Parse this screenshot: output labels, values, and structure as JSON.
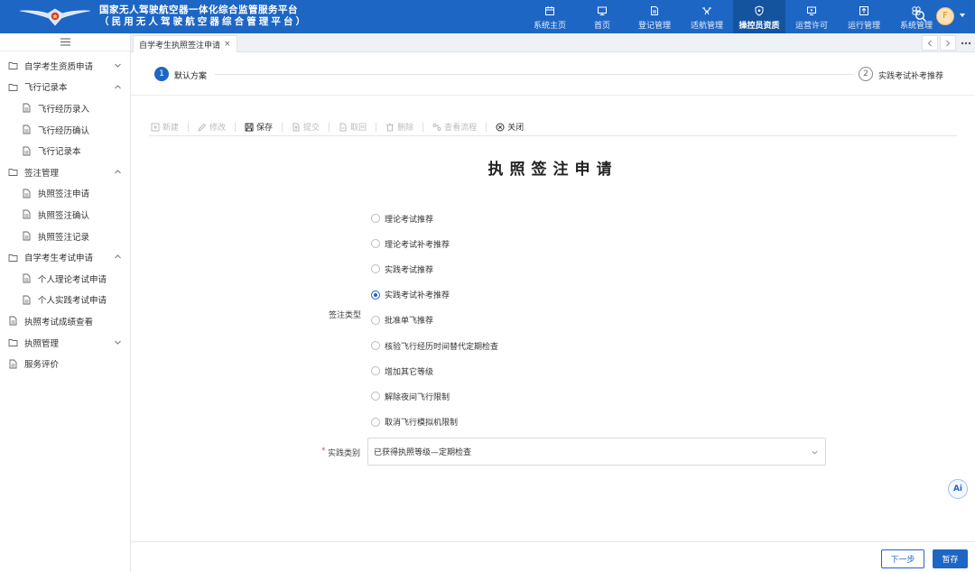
{
  "header": {
    "title": "国家无人驾驶航空器一体化综合监管服务平台",
    "subtitle": "（民用无人驾驶航空器综合管理平台）",
    "avatar_letter": "F",
    "nav": [
      {
        "label": "系统主页",
        "icon": "calendar-icon"
      },
      {
        "label": "首页",
        "icon": "monitor-icon"
      },
      {
        "label": "登记管理",
        "icon": "document-icon"
      },
      {
        "label": "适航管理",
        "icon": "drone-icon"
      },
      {
        "label": "操控员资质",
        "icon": "shield-icon",
        "active": true
      },
      {
        "label": "运营许可",
        "icon": "screen-icon"
      },
      {
        "label": "运行管理",
        "icon": "upload-icon"
      },
      {
        "label": "系统管理",
        "icon": "settings-icon"
      }
    ]
  },
  "sidebar": {
    "items": [
      {
        "label": "自学考生资质申请",
        "level": 0,
        "chev": "down"
      },
      {
        "label": "飞行记录本",
        "level": 0,
        "chev": "up"
      },
      {
        "label": "飞行经历录入",
        "level": 1
      },
      {
        "label": "飞行经历确认",
        "level": 1
      },
      {
        "label": "飞行记录本",
        "level": 1
      },
      {
        "label": "签注管理",
        "level": 0,
        "chev": "up"
      },
      {
        "label": "执照签注申请",
        "level": 1
      },
      {
        "label": "执照签注确认",
        "level": 1
      },
      {
        "label": "执照签注记录",
        "level": 1
      },
      {
        "label": "自学考生考试申请",
        "level": 0,
        "chev": "up"
      },
      {
        "label": "个人理论考试申请",
        "level": 1
      },
      {
        "label": "个人实践考试申请",
        "level": 1
      },
      {
        "label": "执照考试成绩查看",
        "level": 0
      },
      {
        "label": "执照管理",
        "level": 0,
        "chev": "down"
      },
      {
        "label": "服务评价",
        "level": 0
      }
    ]
  },
  "tabs": [
    {
      "label": "自学考生执照签注申请",
      "close": "×"
    }
  ],
  "steps": [
    {
      "num": "1",
      "label": "默认方案"
    },
    {
      "num": "2",
      "label": "实践考试补考推荐"
    }
  ],
  "toolbar": [
    {
      "label": "新建",
      "icon": "plus-square-icon",
      "enabled": false
    },
    {
      "label": "修改",
      "icon": "edit-icon",
      "enabled": false
    },
    {
      "label": "保存",
      "icon": "save-icon",
      "enabled": true
    },
    {
      "label": "提交",
      "icon": "submit-icon",
      "enabled": false
    },
    {
      "label": "取回",
      "icon": "retrieve-icon",
      "enabled": false
    },
    {
      "label": "删除",
      "icon": "trash-icon",
      "enabled": false
    },
    {
      "label": "查看流程",
      "icon": "flow-icon",
      "enabled": false
    },
    {
      "label": "关闭",
      "icon": "close-circle-icon",
      "enabled": true
    }
  ],
  "form": {
    "title": "执照签注申请",
    "type_label": "签注类型",
    "options": [
      "理论考试推荐",
      "理论考试补考推荐",
      "实践考试推荐",
      "实践考试补考推荐",
      "批准单飞推荐",
      "核验飞行经历时间替代定期检查",
      "增加其它等级",
      "解除夜间飞行限制",
      "取消飞行模拟机限制"
    ],
    "selected_index": 3,
    "required_mark": "*",
    "category_label": "实践类别",
    "category_value": "已获得执照等级—定期检查"
  },
  "ai_label": "Ai",
  "footer": {
    "next": "下一步",
    "save": "暂存"
  },
  "colors": {
    "primary": "#1e66c4",
    "active_nav": "#14549f"
  }
}
